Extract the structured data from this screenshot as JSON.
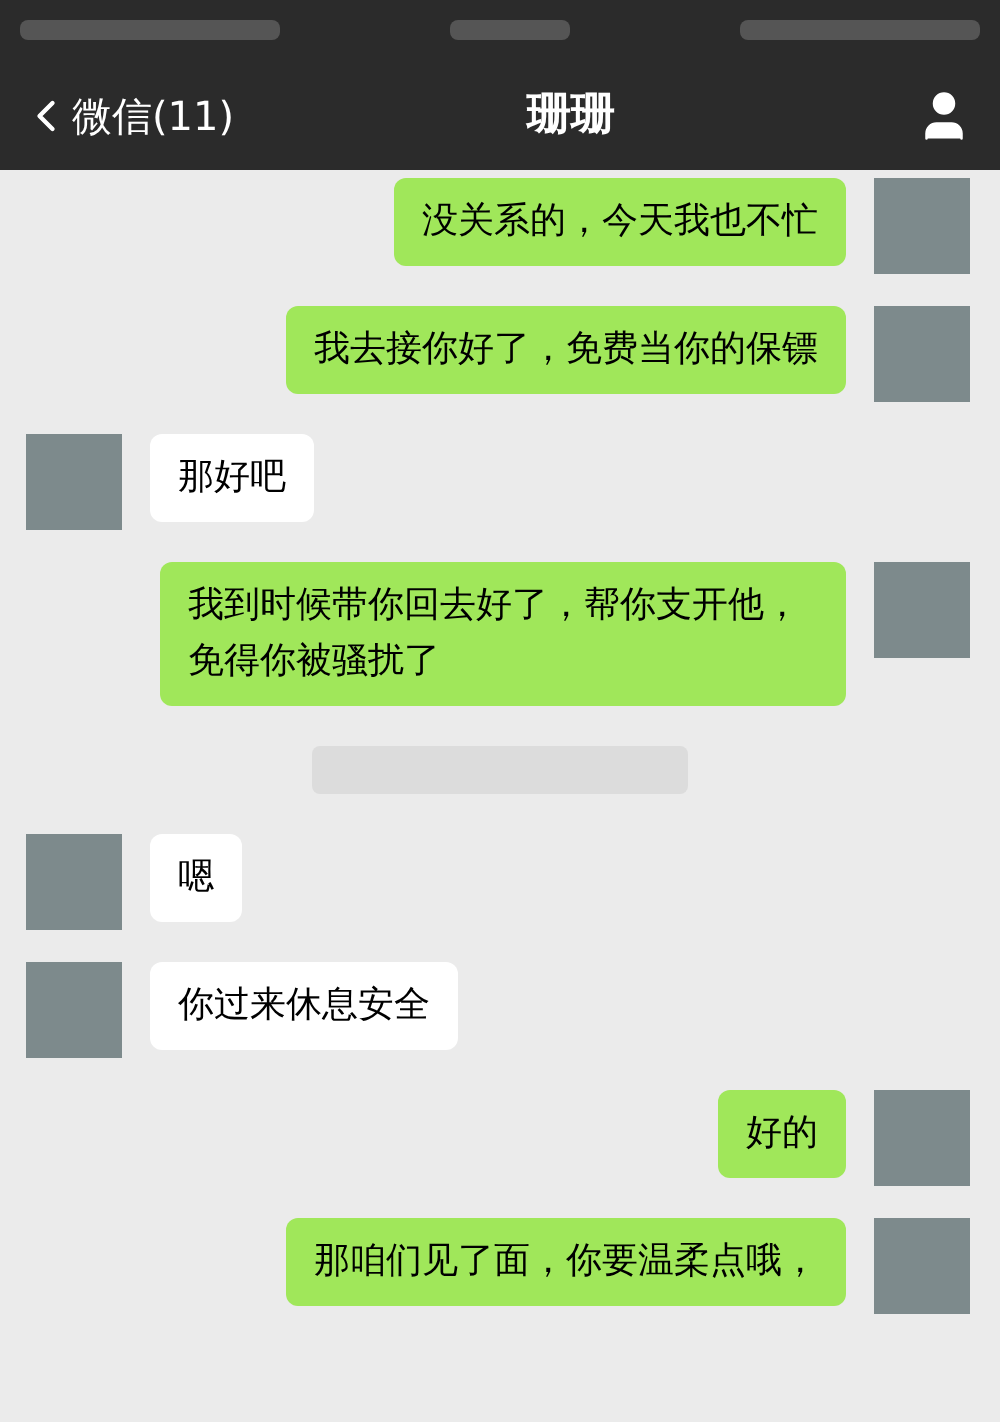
{
  "nav": {
    "back_label": "微信(11)",
    "title": "珊珊"
  },
  "messages": [
    {
      "kind": "sent",
      "text": "没关系的，今天我也不忙"
    },
    {
      "kind": "sent",
      "text": "我去接你好了，免费当你的保镖"
    },
    {
      "kind": "received",
      "text": "那好吧"
    },
    {
      "kind": "sent",
      "text": "我到时候带你回去好了，帮你支开他，免得你被骚扰了"
    },
    {
      "kind": "timestamp"
    },
    {
      "kind": "received",
      "text": "嗯"
    },
    {
      "kind": "received",
      "text": "你过来休息安全"
    },
    {
      "kind": "sent",
      "text": "好的"
    },
    {
      "kind": "sent",
      "text": "那咱们见了面，你要温柔点哦，"
    }
  ]
}
